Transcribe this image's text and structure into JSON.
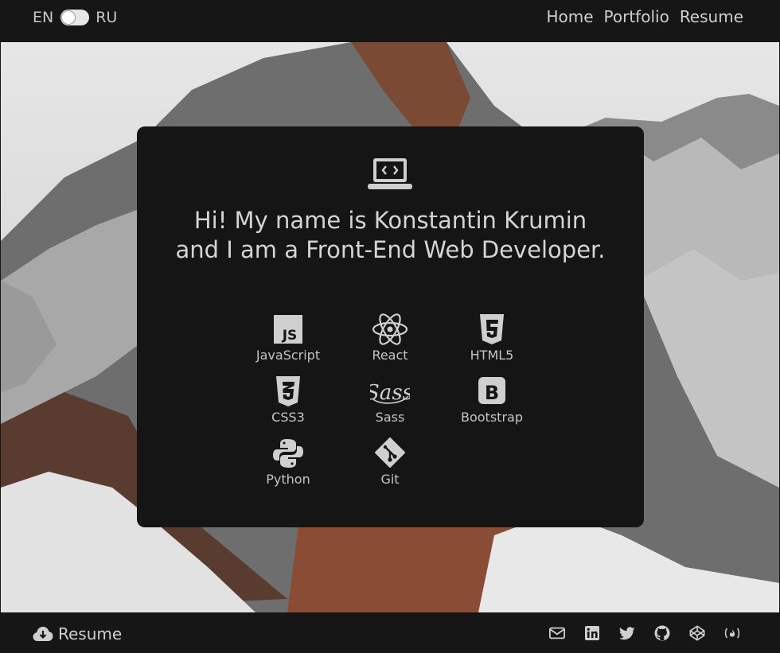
{
  "header": {
    "lang_en": "EN",
    "lang_ru": "RU",
    "nav": [
      "Home",
      "Portfolio",
      "Resume"
    ]
  },
  "card": {
    "headline": "Hi! My name is Konstantin Krumin and I am a Front-End Web Developer.",
    "skills": [
      {
        "label": "JavaScript",
        "icon": "javascript-icon"
      },
      {
        "label": "React",
        "icon": "react-icon"
      },
      {
        "label": "HTML5",
        "icon": "html5-icon"
      },
      {
        "label": "CSS3",
        "icon": "css3-icon"
      },
      {
        "label": "Sass",
        "icon": "sass-icon"
      },
      {
        "label": "Bootstrap",
        "icon": "bootstrap-icon"
      },
      {
        "label": "Python",
        "icon": "python-icon"
      },
      {
        "label": "Git",
        "icon": "git-icon"
      }
    ]
  },
  "footer": {
    "resume_label": "Resume",
    "social_icons": [
      "email-icon",
      "linkedin-icon",
      "twitter-icon",
      "github-icon",
      "codepen-icon",
      "freecodecamp-icon"
    ]
  },
  "colors": {
    "bar_bg": "#161616",
    "card_bg": "#151515",
    "text": "#cfcfcf"
  }
}
